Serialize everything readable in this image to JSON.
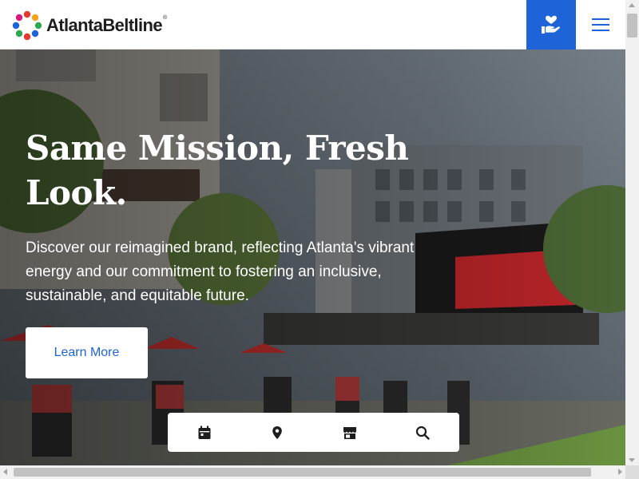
{
  "header": {
    "logo_text": "AtlantaBeltline",
    "logo_mark": "®",
    "donate_icon": "hand-heart-icon",
    "menu_icon": "hamburger-menu-icon"
  },
  "hero": {
    "title": "Same Mission, Fresh Look.",
    "body": "Discover our reimagined brand, reflecting Atlanta's vibrant energy and our commitment to fostering an inclusive, sustainable, and equitable future.",
    "cta_label": "Learn More"
  },
  "quick_links": [
    {
      "icon": "calendar-icon"
    },
    {
      "icon": "map-pin-icon"
    },
    {
      "icon": "storefront-icon"
    },
    {
      "icon": "search-icon"
    }
  ],
  "colors": {
    "brand_blue": "#1e63d8",
    "white": "#ffffff",
    "logo_text": "#1d1d1d"
  }
}
